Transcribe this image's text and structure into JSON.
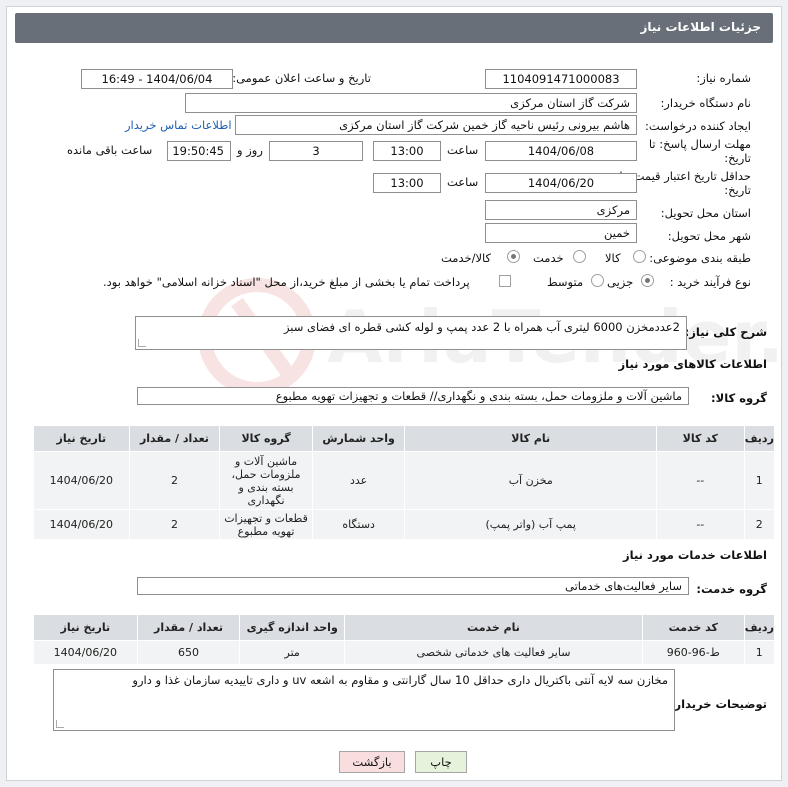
{
  "header": {
    "title": "جزئیات اطلاعات نیاز"
  },
  "fields": {
    "need_number_label": "شماره نیاز:",
    "need_number": "1104091471000083",
    "announce_label": "تاریخ و ساعت اعلان عمومی:",
    "announce_value": "1404/06/04 - 16:49",
    "buyer_org_label": "نام دستگاه خریدار:",
    "buyer_org": "شرکت گاز استان مرکزی",
    "creator_label": "ایجاد کننده درخواست:",
    "creator": "هاشم بیرونی رئیس ناحیه گاز خمین شرکت گاز استان مرکزی",
    "contact_link": "اطلاعات تماس خریدار",
    "reply_deadline_label": "مهلت ارسال پاسخ: تا تاریخ:",
    "reply_date": "1404/06/08",
    "time_label": "ساعت",
    "reply_time": "13:00",
    "days_value": "3",
    "days_label": "روز و",
    "remaining_time": "19:50:45",
    "remaining_label": "ساعت باقی مانده",
    "price_validity_label": "حداقل تاریخ اعتبار قیمت: تا تاریخ:",
    "price_date": "1404/06/20",
    "price_time": "13:00",
    "province_label": "استان محل تحویل:",
    "province": "مرکزی",
    "city_label": "شهر محل تحویل:",
    "city": "خمین",
    "category_label": "طبقه بندی موضوعی:",
    "cat_goods": "کالا",
    "cat_service": "خدمت",
    "cat_both": "کالا/خدمت",
    "process_label": "نوع فرآیند خرید :",
    "proc_minor": "جزیی",
    "proc_medium": "متوسط",
    "payment_note": "پرداخت تمام یا بخشی از مبلغ خرید،از محل \"اسناد خزانه اسلامی\" خواهد بود."
  },
  "description": {
    "label": "شرح کلی نیاز:",
    "text": "2عددمخزن 6000 لیتری آب همراه با 2 عدد پمپ و لوله کشی قطره ای فضای سبز"
  },
  "goods": {
    "section_title": "اطلاعات کالاهای مورد نیاز",
    "group_label": "گروه کالا:",
    "group_value": "ماشین آلات و ملزومات حمل، بسته بندی و نگهداری//  قطعات و تجهیزات تهویه مطبوع",
    "columns": [
      "ردیف",
      "کد کالا",
      "نام کالا",
      "واحد شمارش",
      "گروه کالا",
      "تعداد / مقدار",
      "تاریخ نیاز"
    ],
    "rows": [
      [
        "1",
        "--",
        "مخزن آب",
        "عدد",
        "ماشین آلات و ملزومات حمل، بسته بندی و نگهداری",
        "2",
        "1404/06/20"
      ],
      [
        "2",
        "--",
        "پمپ آب (واتر پمپ)",
        "دستگاه",
        "قطعات و تجهیزات تهویه مطبوع",
        "2",
        "1404/06/20"
      ]
    ]
  },
  "services": {
    "section_title": "اطلاعات خدمات مورد نیاز",
    "group_label": "گروه خدمت:",
    "group_value": "سایر فعالیت‌های خدماتی",
    "columns": [
      "ردیف",
      "کد خدمت",
      "نام خدمت",
      "واحد اندازه گیری",
      "تعداد / مقدار",
      "تاریخ نیاز"
    ],
    "rows": [
      [
        "1",
        "ط-96-960",
        "سایر فعالیت های خدماتی شخصی",
        "متر",
        "650",
        "1404/06/20"
      ]
    ]
  },
  "buyer_notes": {
    "label": "توضیحات خریدار:",
    "text": "مخازن سه لایه آنتی باکتریال داری حداقل 10 سال گارانتی و مقاوم به اشعه uv و داری تاییدیه سازمان غذا و دارو"
  },
  "buttons": {
    "print": "چاپ",
    "back": "بازگشت"
  },
  "colors": {
    "header_bg": "#686f78",
    "link": "#1f5fb5",
    "back_btn_bg": "#f8dede",
    "print_btn_bg": "#e6f3dc"
  }
}
